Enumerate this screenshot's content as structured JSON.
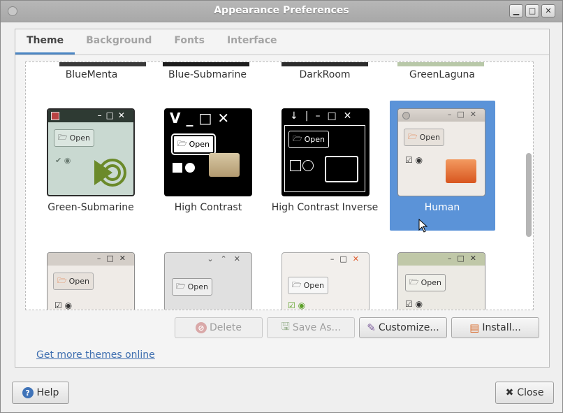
{
  "window": {
    "title": "Appearance Preferences"
  },
  "tabs": [
    {
      "label": "Theme",
      "active": true
    },
    {
      "label": "Background"
    },
    {
      "label": "Fonts"
    },
    {
      "label": "Interface"
    }
  ],
  "themes": {
    "top_row": [
      "BlueMenta",
      "Blue-Submarine",
      "DarkRoom",
      "GreenLaguna"
    ],
    "middle_row": [
      {
        "name": "Green-Submarine"
      },
      {
        "name": "High Contrast"
      },
      {
        "name": "High Contrast Inverse"
      },
      {
        "name": "Human",
        "selected": true
      }
    ],
    "preview_open_label": "Open"
  },
  "actions": {
    "delete": "Delete",
    "save_as": "Save As...",
    "customize": "Customize...",
    "install": "Install..."
  },
  "link": "Get more themes online",
  "bottom": {
    "help": "Help",
    "close": "Close"
  },
  "colors": {
    "selection": "#5b93d8",
    "link": "#3f6fb0"
  }
}
